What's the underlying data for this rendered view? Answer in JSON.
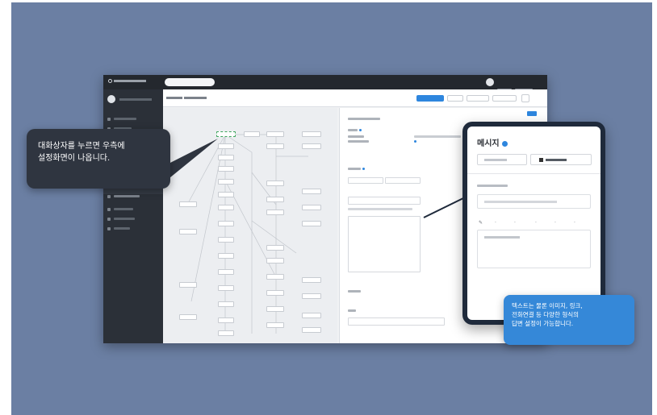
{
  "callouts": {
    "left_line1": "대화상자를 누르면 우측에",
    "left_line2": "설정화면이 나옵니다.",
    "right_line1": "텍스트는 물론 이미지, 링크,",
    "right_line2": "전화연결 등 다양한 형식의",
    "right_line3": "답변 설정이 가능합니다."
  },
  "tablet": {
    "title": "메시지"
  },
  "colors": {
    "stage_background": "#6b7fa3",
    "app_topbar": "#24282e",
    "sidebar": "#2b3038",
    "accent": "#2e86de",
    "right_callout": "#3588d8",
    "left_callout": "#2f3540",
    "tablet_frame": "#1f2a3b"
  },
  "icons": {
    "tablet_title_badge": "info-badge-icon",
    "tablet_add_button": "add-icon"
  }
}
